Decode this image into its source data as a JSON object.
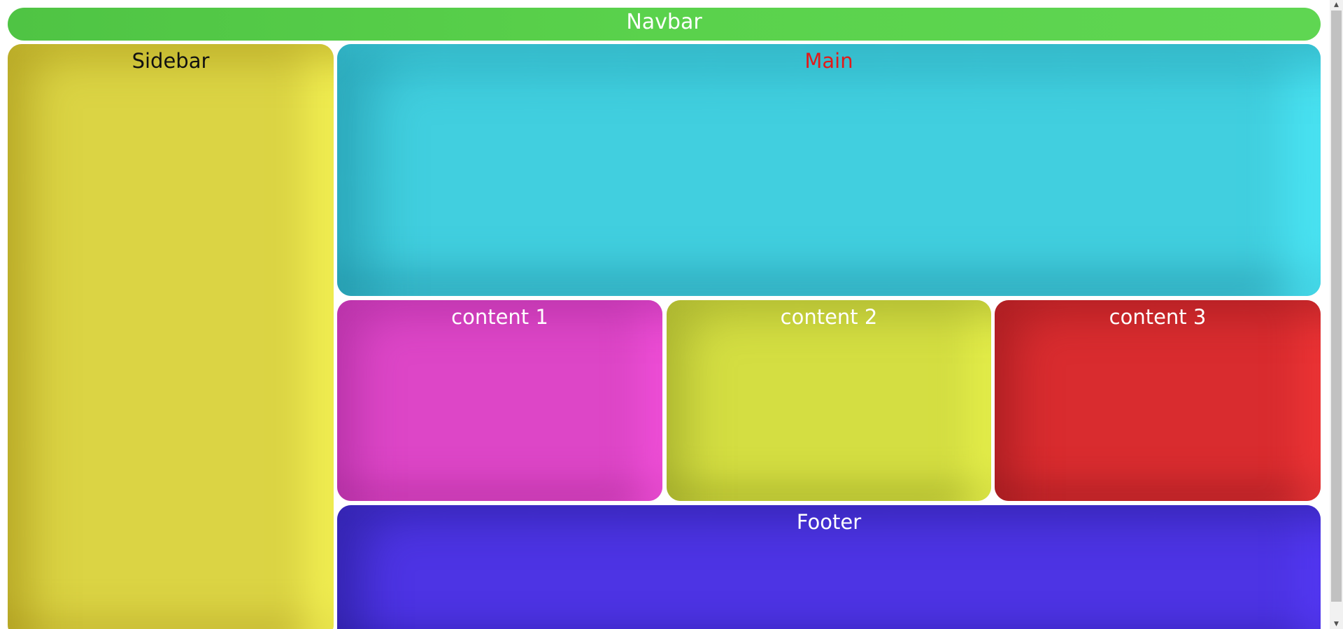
{
  "navbar": {
    "label": "Navbar",
    "color": "#5ad24c"
  },
  "sidebar": {
    "label": "Sidebar",
    "color": "#dbd444"
  },
  "main": {
    "label": "Main",
    "color": "#41cfdf",
    "text_color": "#e21a1a"
  },
  "content": [
    {
      "label": "content 1",
      "color": "#dd46c7"
    },
    {
      "label": "content 2",
      "color": "#d4de42"
    },
    {
      "label": "content 3",
      "color": "#d92c2f"
    }
  ],
  "footer": {
    "label": "Footer",
    "color": "#4d34e4"
  },
  "scrollbar": {
    "up_icon": "triangle-up-icon",
    "down_icon": "triangle-down-icon",
    "up_glyph": "▲",
    "down_glyph": "▼"
  }
}
